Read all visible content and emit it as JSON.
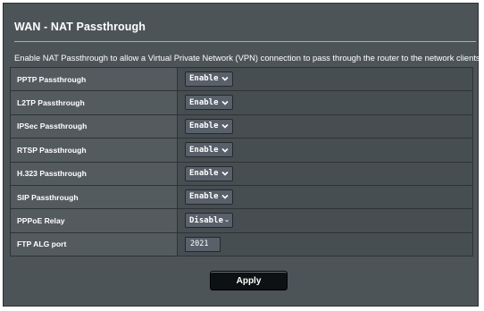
{
  "header": {
    "title": "WAN - NAT Passthrough"
  },
  "description": "Enable NAT Passthrough to allow a Virtual Private Network (VPN) connection to pass through the router to the network clients.",
  "settings": [
    {
      "label": "PPTP Passthrough",
      "value": "Enable"
    },
    {
      "label": "L2TP Passthrough",
      "value": "Enable"
    },
    {
      "label": "IPSec Passthrough",
      "value": "Enable"
    },
    {
      "label": "RTSP Passthrough",
      "value": "Enable"
    },
    {
      "label": "H.323 Passthrough",
      "value": "Enable"
    },
    {
      "label": "SIP Passthrough",
      "value": "Enable"
    },
    {
      "label": "PPPoE Relay",
      "value": "Disable"
    }
  ],
  "ftp": {
    "label": "FTP ALG port",
    "value": "2021"
  },
  "actions": {
    "apply_label": "Apply"
  },
  "icons": {
    "dropdown": "chevron-down-icon"
  },
  "colors": {
    "panel_bg": "#4d5458",
    "label_cell_bg": "#545b5f",
    "value_cell_bg": "#474e52",
    "button_bg": "#0e1113",
    "text": "#ffffff"
  }
}
